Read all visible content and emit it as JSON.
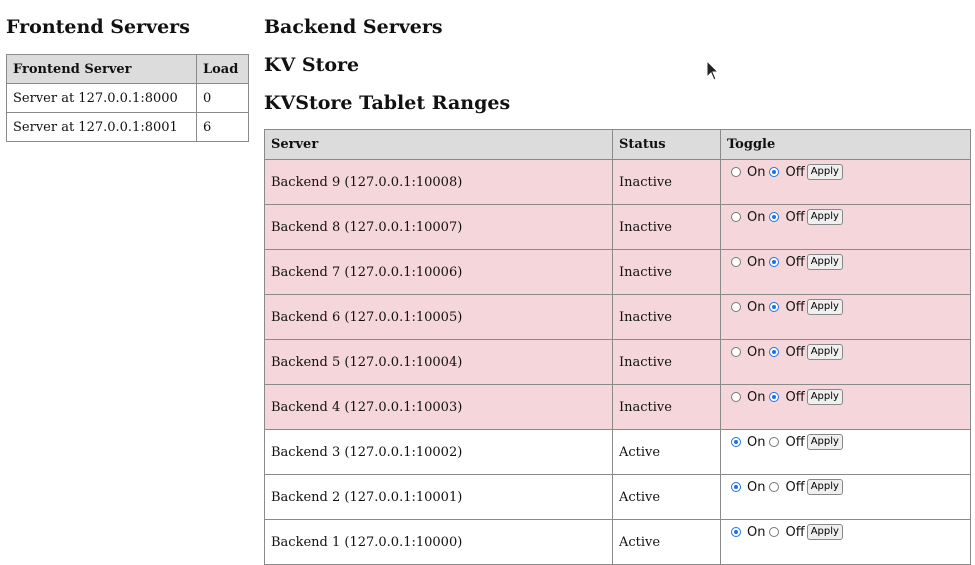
{
  "headings": {
    "frontend": "Frontend Servers",
    "backend": "Backend Servers",
    "kvstore": "KV Store",
    "tablet_ranges": "KVStore Tablet Ranges"
  },
  "frontend_table": {
    "headers": [
      "Frontend Server",
      "Load"
    ],
    "rows": [
      {
        "server": "Server at 127.0.0.1:8000",
        "load": "0"
      },
      {
        "server": "Server at 127.0.0.1:8001",
        "load": "6"
      }
    ]
  },
  "backend_table": {
    "headers": [
      "Server",
      "Status",
      "Toggle"
    ],
    "on_label": "On",
    "off_label": "Off",
    "apply_label": "Apply",
    "rows": [
      {
        "server": "Backend 9 (127.0.0.1:10008)",
        "status": "Inactive",
        "on": false
      },
      {
        "server": "Backend 8 (127.0.0.1:10007)",
        "status": "Inactive",
        "on": false
      },
      {
        "server": "Backend 7 (127.0.0.1:10006)",
        "status": "Inactive",
        "on": false
      },
      {
        "server": "Backend 6 (127.0.0.1:10005)",
        "status": "Inactive",
        "on": false
      },
      {
        "server": "Backend 5 (127.0.0.1:10004)",
        "status": "Inactive",
        "on": false
      },
      {
        "server": "Backend 4 (127.0.0.1:10003)",
        "status": "Inactive",
        "on": false
      },
      {
        "server": "Backend 3 (127.0.0.1:10002)",
        "status": "Active",
        "on": true
      },
      {
        "server": "Backend 2 (127.0.0.1:10001)",
        "status": "Active",
        "on": true
      },
      {
        "server": "Backend 1 (127.0.0.1:10000)",
        "status": "Active",
        "on": true
      }
    ]
  },
  "colors": {
    "inactive_row": "#f5d7db",
    "header_bg": "#dcdcdc",
    "radio_accent": "#1a73e8"
  }
}
